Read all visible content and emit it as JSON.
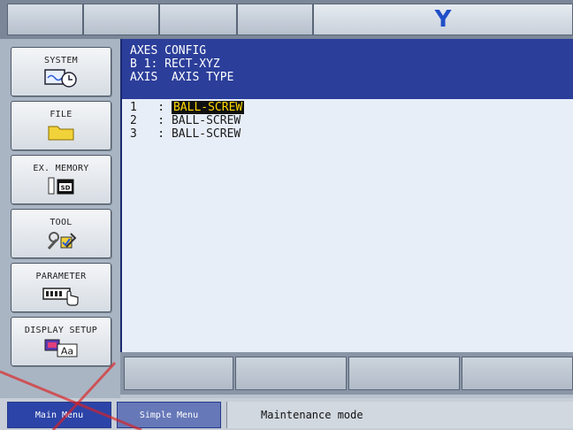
{
  "top_bar": {
    "axis_indicator": "Y"
  },
  "sidebar": {
    "items": [
      {
        "label": "SYSTEM",
        "icon": "system-monitor-clock-icon"
      },
      {
        "label": "FILE",
        "icon": "folder-icon"
      },
      {
        "label": "EX. MEMORY",
        "icon": "sd-card-icon"
      },
      {
        "label": "TOOL",
        "icon": "wrench-tool-icon"
      },
      {
        "label": "PARAMETER",
        "icon": "parameter-hand-icon"
      },
      {
        "label": "DISPLAY SETUP",
        "icon": "display-font-icon"
      }
    ]
  },
  "main": {
    "title": "AXES CONFIG",
    "group": "B 1: RECT-XYZ",
    "column_headers": "AXIS  AXIS TYPE",
    "rows": [
      {
        "axis": "1",
        "type": "BALL-SCREW",
        "selected": true
      },
      {
        "axis": "2",
        "type": "BALL-SCREW",
        "selected": false
      },
      {
        "axis": "3",
        "type": "BALL-SCREW",
        "selected": false
      }
    ]
  },
  "footer": {
    "main_menu": "Main Menu",
    "simple_menu": "Simple Menu",
    "status": "Maintenance mode"
  },
  "colors": {
    "header_bg": "#2b3e9a",
    "panel_bg": "#e8eef8",
    "selection_bg": "#101010",
    "selection_fg": "#ffd800",
    "axis_indicator": "#1f4fc8"
  }
}
